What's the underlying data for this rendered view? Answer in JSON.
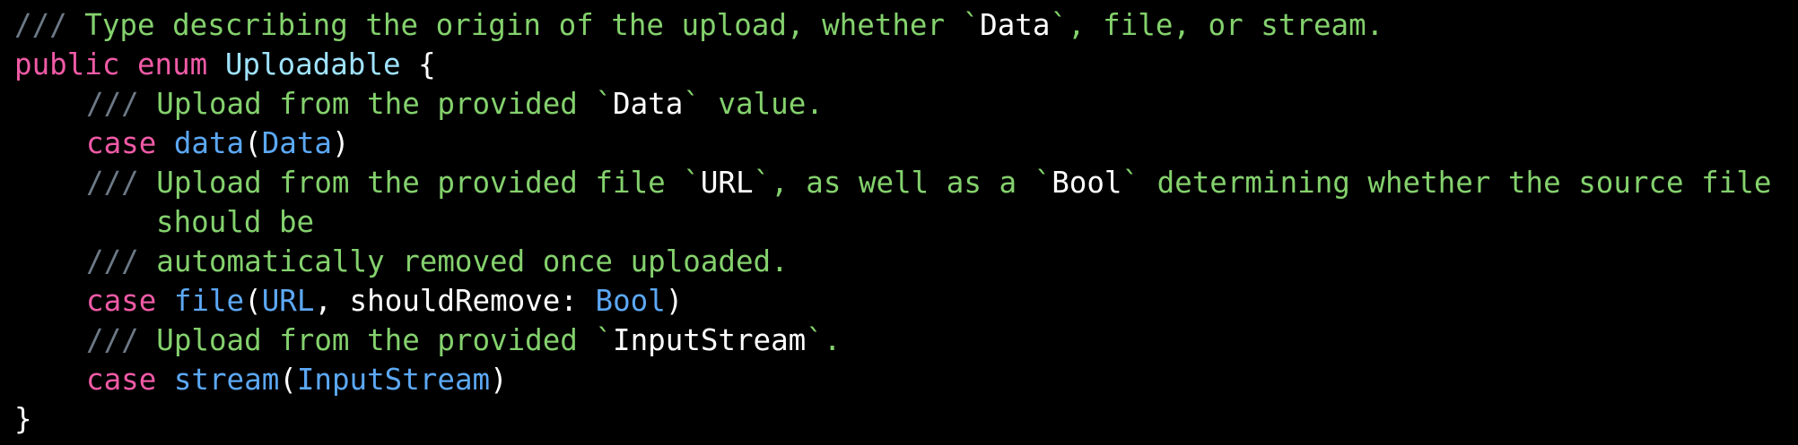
{
  "code": {
    "lines": [
      {
        "marker": "///",
        "comment_pre": " Type describing the origin of the upload, whether `",
        "literal": "Data",
        "comment_post": "`, file, or stream."
      },
      {
        "kw1": "public",
        "kw2": "enum",
        "name": "Uploadable",
        "brace": "{"
      },
      {
        "marker": "///",
        "comment_pre": " Upload from the provided `",
        "literal": "Data",
        "comment_post": "` value."
      },
      {
        "kw": "case",
        "func": "data",
        "open": "(",
        "type": "Data",
        "close": ")"
      },
      {
        "marker": "///",
        "comment_pre": " Upload from the provided file `",
        "literal1": "URL",
        "comment_mid": "`, as well as a `",
        "literal2": "Bool",
        "comment_post": "` determining whether the source file"
      },
      {
        "continuation": "should be"
      },
      {
        "marker": "///",
        "comment": " automatically removed once uploaded."
      },
      {
        "kw": "case",
        "func": "file",
        "open": "(",
        "type1": "URL",
        "param": ", shouldRemove: ",
        "type2": "Bool",
        "close": ")"
      },
      {
        "marker": "///",
        "comment_pre": " Upload from the provided `",
        "literal": "InputStream",
        "comment_post": "`."
      },
      {
        "kw": "case",
        "func": "stream",
        "open": "(",
        "type": "InputStream",
        "close": ")"
      },
      {
        "brace": "}"
      }
    ]
  },
  "colors": {
    "background": "#000000",
    "comment": "#84d16d",
    "comment_marker": "#6c7986",
    "keyword": "#f05aa6",
    "declared_type": "#9fe3ff",
    "referenced_type": "#5ca8f5",
    "plain_text": "#ffffff"
  }
}
